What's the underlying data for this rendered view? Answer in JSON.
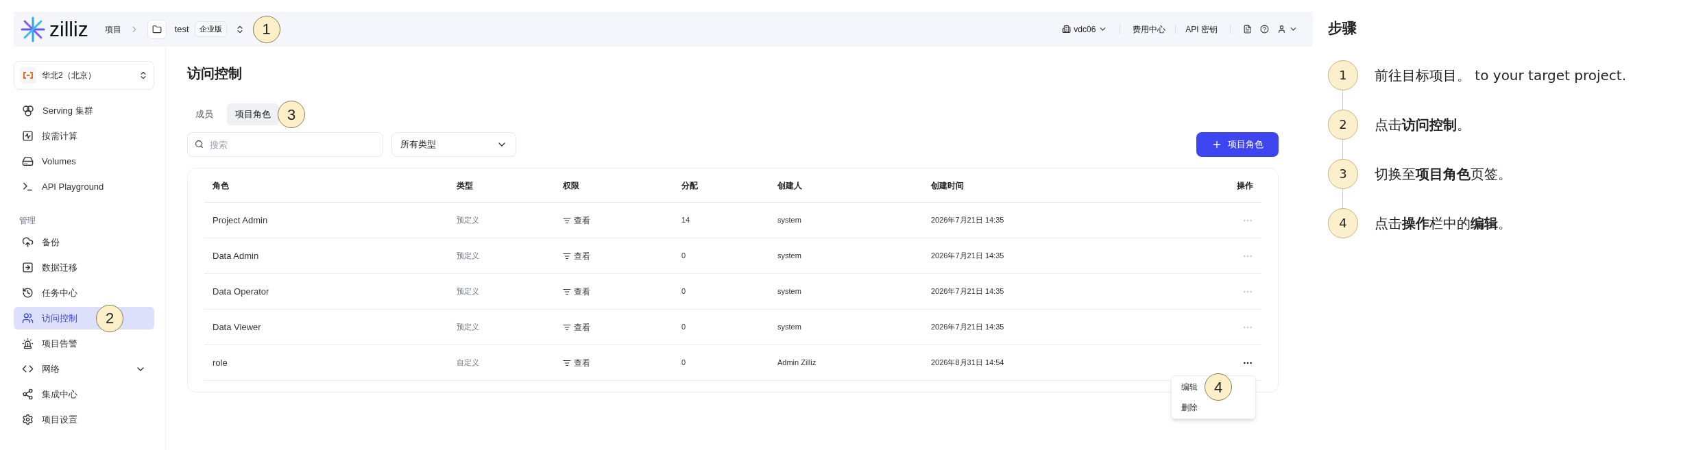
{
  "topbar": {
    "logo": "zilliz",
    "breadcrumb": [
      {
        "label": "项目"
      },
      {
        "label": "test",
        "badge": "企业版"
      }
    ],
    "env": "vdc06",
    "links": [
      "费用中心",
      "API 密钥"
    ]
  },
  "sidebar": {
    "region": "华北2（北京）",
    "items": [
      {
        "label": "Serving 集群",
        "selected": false,
        "kind": "link"
      },
      {
        "label": "按需计算",
        "selected": false,
        "kind": "link"
      },
      {
        "label": "Volumes",
        "selected": false,
        "kind": "link"
      },
      {
        "label": "API Playground",
        "selected": false,
        "kind": "link"
      }
    ],
    "section": "管理",
    "section_items": [
      {
        "label": "备份",
        "selected": false,
        "kind": "link"
      },
      {
        "label": "数据迁移",
        "selected": false,
        "kind": "link"
      },
      {
        "label": "任务中心",
        "selected": false,
        "kind": "link"
      },
      {
        "label": "访问控制",
        "selected": true,
        "kind": "link"
      },
      {
        "label": "项目告警",
        "selected": false,
        "kind": "link"
      },
      {
        "label": "网络",
        "selected": false,
        "kind": "group"
      },
      {
        "label": "集成中心",
        "selected": false,
        "kind": "link"
      },
      {
        "label": "项目设置",
        "selected": false,
        "kind": "link"
      }
    ]
  },
  "page": {
    "title": "访问控制",
    "tabs": [
      {
        "label": "成员",
        "selected": false
      },
      {
        "label": "项目角色",
        "selected": true
      }
    ],
    "search": {
      "placeholder": "搜索"
    },
    "type_filter": "所有类型",
    "add_button": "项目角色",
    "table": {
      "columns": [
        "角色",
        "类型",
        "权限",
        "分配",
        "创建人",
        "创建时间",
        "操作"
      ],
      "rows": [
        {
          "role": "Project Admin",
          "type": "预定义",
          "permission": "查看",
          "assigned": "14",
          "creator": "system",
          "created": "2026年7月21日 14:35",
          "menu_open": false
        },
        {
          "role": "Data Admin",
          "type": "预定义",
          "permission": "查看",
          "assigned": "0",
          "creator": "system",
          "created": "2026年7月21日 14:35",
          "menu_open": false
        },
        {
          "role": "Data Operator",
          "type": "预定义",
          "permission": "查看",
          "assigned": "0",
          "creator": "system",
          "created": "2026年7月21日 14:35",
          "menu_open": false
        },
        {
          "role": "Data Viewer",
          "type": "预定义",
          "permission": "查看",
          "assigned": "0",
          "creator": "system",
          "created": "2026年7月21日 14:35",
          "menu_open": false
        },
        {
          "role": "role",
          "type": "自定义",
          "permission": "查看",
          "assigned": "0",
          "creator": "Admin Zilliz",
          "created": "2026年8月31日 14:54",
          "menu_open": true
        }
      ],
      "row_menu": [
        "编辑",
        "删除"
      ]
    }
  },
  "callouts": [
    "1",
    "2",
    "3",
    "4"
  ],
  "steps_panel": {
    "title": "步骤",
    "steps": [
      {
        "number": "1",
        "text": "前往目标项目。 to your target project."
      },
      {
        "number": "2",
        "text": "点击**访问控制**。"
      },
      {
        "number": "3",
        "text": "切换至**项目角色**页签。"
      },
      {
        "number": "4",
        "text": "点击**操作**栏中的**编辑**。"
      }
    ]
  }
}
